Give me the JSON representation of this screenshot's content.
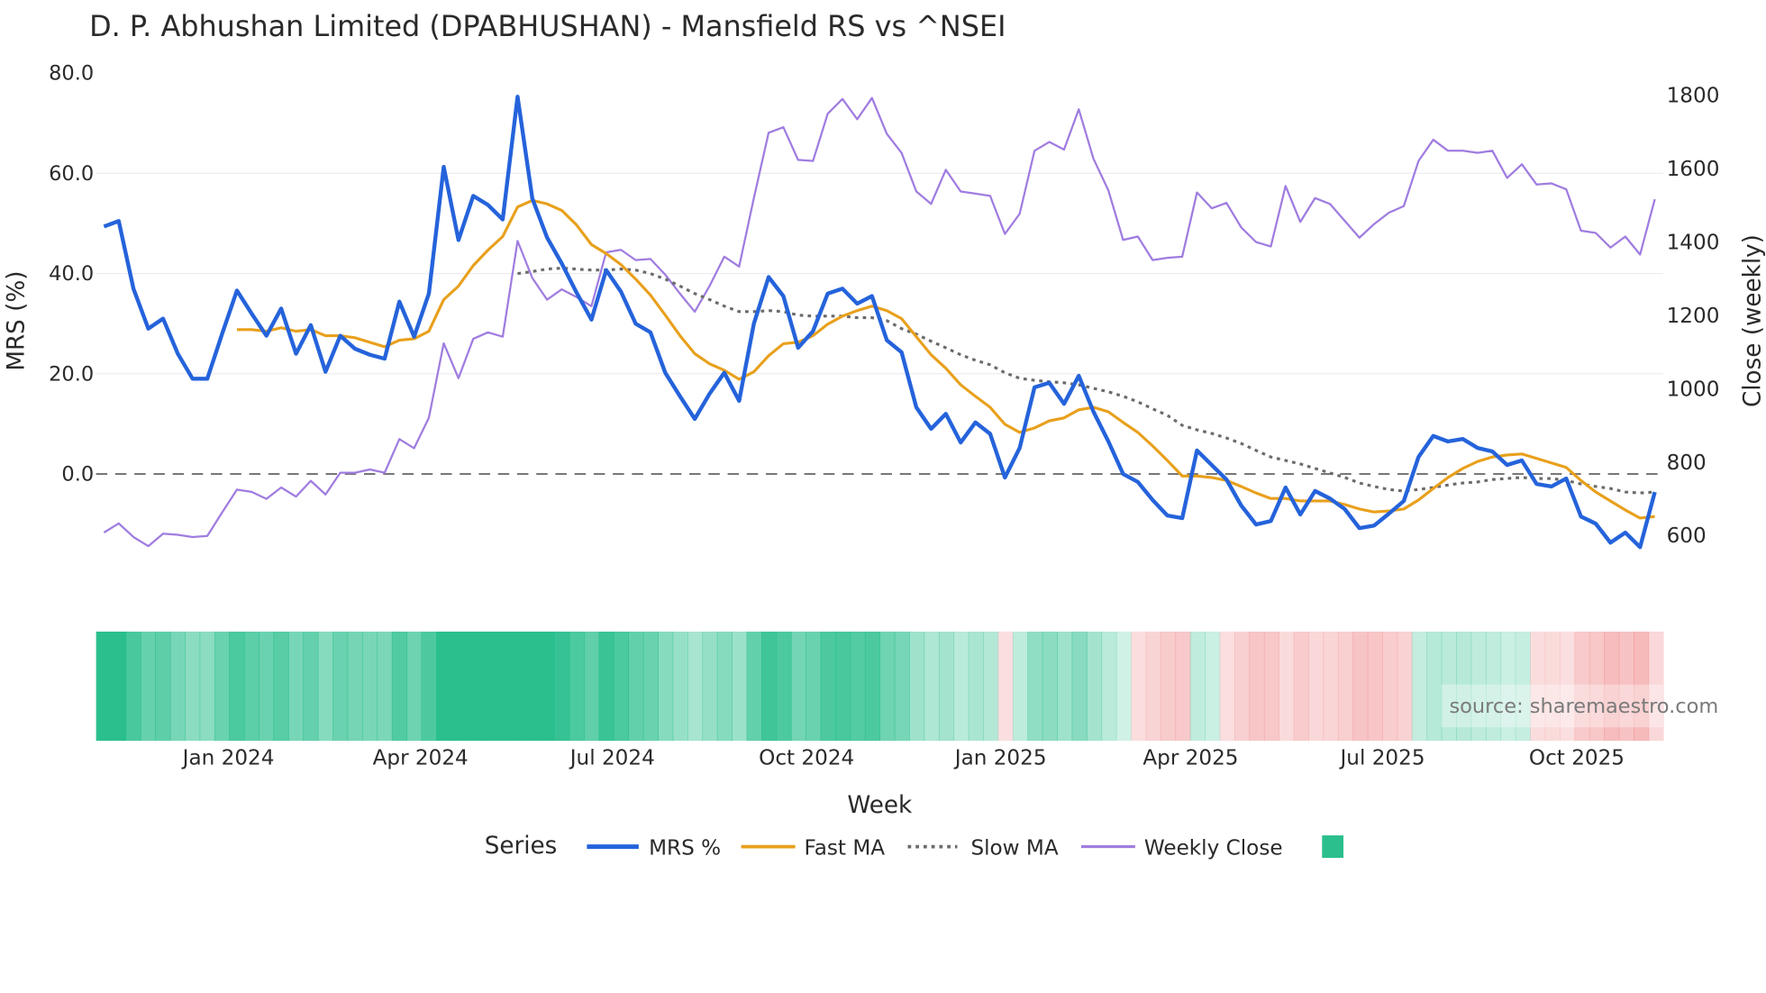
{
  "chart_data": {
    "type": "line",
    "title": "D. P. Abhushan Limited (DPABHUSHAN) - Mansfield RS vs ^NSEI",
    "xlabel": "Week",
    "ylabel": "MRS (%)",
    "y2label": "Close (weekly)",
    "x_start": "2023-11-03",
    "x_step_days": 7,
    "ylim": [
      -20,
      80
    ],
    "y2lim": [
      540,
      1860
    ],
    "y_ticks": [
      "80.0",
      "60.0",
      "40.0",
      "20.0",
      "0.0"
    ],
    "y_tick_values": [
      80,
      60,
      40,
      20,
      0
    ],
    "y2_ticks": [
      "1800",
      "1600",
      "1400",
      "1200",
      "1000",
      "800",
      "600"
    ],
    "y2_tick_values": [
      1800,
      1600,
      1400,
      1200,
      1000,
      800,
      600
    ],
    "x_ticks": [
      {
        "label": "Jan 2024",
        "date": "2024-01-01"
      },
      {
        "label": "Apr 2024",
        "date": "2024-04-01"
      },
      {
        "label": "Jul 2024",
        "date": "2024-07-01"
      },
      {
        "label": "Oct 2024",
        "date": "2024-10-01"
      },
      {
        "label": "Jan 2025",
        "date": "2025-01-01"
      },
      {
        "label": "Apr 2025",
        "date": "2025-04-01"
      },
      {
        "label": "Jul 2025",
        "date": "2025-07-01"
      },
      {
        "label": "Oct 2025",
        "date": "2025-10-01"
      }
    ],
    "grid": true,
    "zero_line": 0,
    "legend_title": "Series",
    "legend_position": "bottom-center",
    "series": [
      {
        "name": "MRS %",
        "color": "#2563db",
        "axis": "left",
        "start_index": 0,
        "values": [
          49.4,
          50.5,
          37,
          29,
          31,
          24,
          19,
          19,
          28,
          36.6,
          32,
          27.6,
          33,
          24,
          29.7,
          20.4,
          27.6,
          25,
          23.8,
          23,
          34.4,
          27.4,
          36,
          61.3,
          46.7,
          55.5,
          53.7,
          50.8,
          75.3,
          55,
          47.2,
          42,
          36.2,
          30.8,
          40.7,
          36.4,
          30,
          28.3,
          20.2,
          15.5,
          11,
          16,
          20.2,
          14.6,
          30,
          39.3,
          35.5,
          25.2,
          28.5,
          36,
          37,
          34,
          35.5,
          26.7,
          24.3,
          13.3,
          9,
          12,
          6.3,
          10.3,
          8,
          -0.7,
          5.2,
          17.3,
          18.2,
          14,
          19.6,
          12.4,
          6.5,
          0,
          -1.6,
          -5.2,
          -8.3,
          -8.8,
          4.7,
          1.8,
          -1.1,
          -6.3,
          -10.1,
          -9.4,
          -2.7,
          -8.1,
          -3.4,
          -4.9,
          -7,
          -10.8,
          -10.3,
          -7.9,
          -5.4,
          3.4,
          7.6,
          6.5,
          7,
          5.2,
          4.5,
          1.8,
          2.7,
          -2,
          -2.5,
          -0.9,
          -8.5,
          -9.9,
          -13.7,
          -11.7,
          -14.6,
          -3.6
        ]
      },
      {
        "name": "Fast MA",
        "color": "#e8a01c",
        "axis": "left",
        "start_index": 9,
        "values": [
          28.8,
          28.8,
          28.5,
          29.2,
          28.5,
          28.8,
          27.6,
          27.6,
          27.2,
          26.3,
          25.4,
          26.7,
          27,
          28.5,
          34.8,
          37.5,
          41.6,
          44.7,
          47.4,
          53.3,
          54.6,
          53.9,
          52.6,
          49.7,
          45.8,
          44,
          41.8,
          38.9,
          35.7,
          31.7,
          27.6,
          24,
          22,
          20.7,
          18.9,
          20.4,
          23.6,
          26,
          26.3,
          27.6,
          29.9,
          31.5,
          32.6,
          33.5,
          32.6,
          31,
          27.4,
          23.8,
          21.1,
          17.8,
          15.5,
          13.3,
          9.9,
          8.3,
          9.2,
          10.6,
          11.2,
          12.8,
          13.3,
          12.4,
          10.3,
          8.3,
          5.6,
          2.7,
          -0.4,
          -0.4,
          -0.7,
          -1.3,
          -2.5,
          -3.8,
          -4.9,
          -4.9,
          -5.4,
          -5.4,
          -5.4,
          -6.1,
          -7,
          -7.6,
          -7.4,
          -7,
          -5.2,
          -2.9,
          -0.7,
          1.1,
          2.5,
          3.4,
          3.8,
          4,
          3.1,
          2.2,
          1.3,
          -1.3,
          -3.6,
          -5.4,
          -7.2,
          -8.8,
          -8.5
        ]
      },
      {
        "name": "Slow MA",
        "color": "#6b6b6b",
        "axis": "left",
        "dash": "dotted",
        "start_index": 28,
        "values": [
          40,
          40.4,
          40.9,
          41.1,
          40.9,
          40.7,
          40.7,
          40.9,
          40.7,
          40,
          38.9,
          37.5,
          36,
          34.8,
          33.5,
          32.4,
          32.4,
          32.6,
          32.4,
          31.7,
          31.5,
          31.5,
          31.5,
          31.2,
          31.2,
          30.6,
          29,
          27.9,
          26.5,
          25.2,
          23.8,
          22.7,
          21.8,
          20.2,
          19.1,
          18.7,
          18.4,
          18.2,
          17.8,
          17.1,
          16.4,
          15.5,
          14.4,
          13,
          11.7,
          9.7,
          8.8,
          8.1,
          7.2,
          6.1,
          4.7,
          3.4,
          2.7,
          2,
          1.1,
          0.2,
          -0.7,
          -1.8,
          -2.5,
          -3.1,
          -3.4,
          -3.1,
          -2.7,
          -2.2,
          -1.8,
          -1.6,
          -1.1,
          -0.9,
          -0.7,
          -0.9,
          -0.9,
          -1.3,
          -2,
          -2.5,
          -2.9,
          -3.6,
          -3.8,
          -3.6
        ]
      },
      {
        "name": "Weekly Close",
        "color": "#a07ce0",
        "axis": "right",
        "start_index": 0,
        "values": [
          606,
          631,
          594,
          569,
          603,
          600,
          594,
          597,
          661,
          723,
          717,
          698,
          729,
          704,
          747,
          710,
          769,
          769,
          778,
          769,
          861,
          836,
          919,
          1122,
          1027,
          1134,
          1152,
          1140,
          1401,
          1300,
          1241,
          1269,
          1248,
          1223,
          1370,
          1377,
          1349,
          1352,
          1309,
          1257,
          1208,
          1278,
          1358,
          1331,
          1518,
          1696,
          1711,
          1622,
          1619,
          1748,
          1788,
          1733,
          1791,
          1693,
          1641,
          1536,
          1502,
          1595,
          1536,
          1530,
          1524,
          1420,
          1475,
          1647,
          1671,
          1650,
          1760,
          1625,
          1539,
          1404,
          1413,
          1349,
          1355,
          1358,
          1533,
          1490,
          1505,
          1438,
          1398,
          1386,
          1551,
          1453,
          1518,
          1502,
          1456,
          1410,
          1447,
          1478,
          1496,
          1619,
          1677,
          1647,
          1647,
          1641,
          1647,
          1573,
          1610,
          1555,
          1558,
          1542,
          1429,
          1423,
          1383,
          1413,
          1364,
          1515
        ]
      }
    ],
    "heatmap": {
      "source_series": "MRS %",
      "positive_color": "#2bbf8e",
      "negative_color": "#f08a8c",
      "legend_swatch_color": "#2bbf8e"
    },
    "annotation": "source: sharemaestro.com"
  }
}
